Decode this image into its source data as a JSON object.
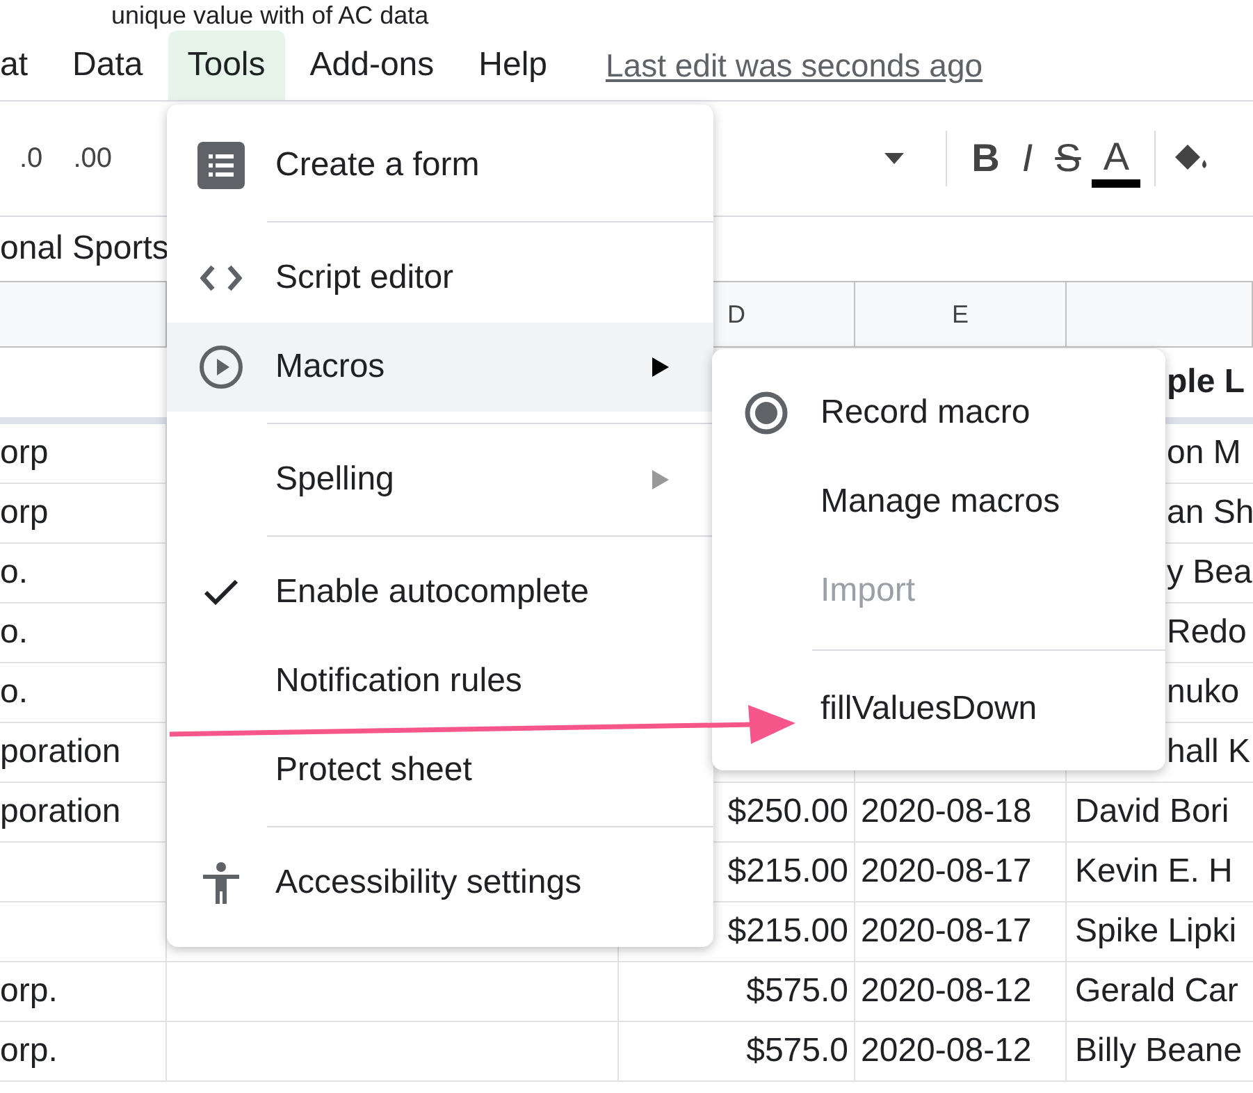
{
  "title": "unique value with of AC data",
  "menubar": [
    {
      "label": "at",
      "selected": false
    },
    {
      "label": "Data",
      "selected": false
    },
    {
      "label": "Tools",
      "selected": true
    },
    {
      "label": "Add-ons",
      "selected": false
    },
    {
      "label": "Help",
      "selected": false
    }
  ],
  "last_edit": "Last edit was seconds ago",
  "toolbar": {
    "decimals": [
      ".0",
      ".00"
    ],
    "format": [
      "B",
      "I",
      "S",
      "A"
    ]
  },
  "formula_bar": "onal Sports",
  "columns": [
    "D",
    "E"
  ],
  "header_cell": "ple L",
  "rows": [
    {
      "a": "orp",
      "amount": "",
      "date": "",
      "f": "on M"
    },
    {
      "a": "orp",
      "amount": "",
      "date": "",
      "f": "an Sh"
    },
    {
      "a": "o.",
      "amount": "",
      "date": "",
      "f": "y Bea"
    },
    {
      "a": "o.",
      "amount": "",
      "date": "",
      "f": "Redo"
    },
    {
      "a": "o.",
      "amount": "",
      "date": "",
      "f": "nuko"
    },
    {
      "a": "poration",
      "amount": "",
      "date": "",
      "f": "hall K"
    },
    {
      "a": "poration",
      "amount": "$250.00",
      "date": "2020-08-18",
      "f": "David Bori"
    },
    {
      "a": "",
      "amount": "$215.00",
      "date": "2020-08-17",
      "f": "Kevin E. H"
    },
    {
      "a": "",
      "amount": "$215.00",
      "date": "2020-08-17",
      "f": "Spike Lipki"
    },
    {
      "a": "orp.",
      "amount": "$575.0",
      "date": "2020-08-12",
      "f": "Gerald Car"
    },
    {
      "a": "orp.",
      "amount": "$575.0",
      "date": "2020-08-12",
      "f": "Billy Beane"
    }
  ],
  "tools_menu": [
    {
      "kind": "item",
      "label": "Create a form",
      "selected": false,
      "checked": false,
      "submenu": false
    },
    {
      "kind": "divider"
    },
    {
      "kind": "item",
      "label": "Script editor",
      "selected": false,
      "checked": false,
      "submenu": false
    },
    {
      "kind": "item",
      "label": "Macros",
      "selected": true,
      "checked": false,
      "submenu": true
    },
    {
      "kind": "divider"
    },
    {
      "kind": "item",
      "label": "Spelling",
      "selected": false,
      "checked": false,
      "submenu": true
    },
    {
      "kind": "divider"
    },
    {
      "kind": "item",
      "label": "Enable autocomplete",
      "selected": false,
      "checked": true,
      "submenu": false
    },
    {
      "kind": "item",
      "label": "Notification rules",
      "selected": false,
      "checked": false,
      "submenu": false
    },
    {
      "kind": "item",
      "label": "Protect sheet",
      "selected": false,
      "checked": false,
      "submenu": false
    },
    {
      "kind": "divider"
    },
    {
      "kind": "item",
      "label": "Accessibility settings",
      "selected": false,
      "checked": false,
      "submenu": false
    }
  ],
  "macros_menu": [
    {
      "kind": "item",
      "label": "Record macro",
      "disabled": false
    },
    {
      "kind": "item",
      "label": "Manage macros",
      "disabled": false
    },
    {
      "kind": "item",
      "label": "Import",
      "disabled": true
    },
    {
      "kind": "divider"
    },
    {
      "kind": "item",
      "label": "fillValuesDown",
      "disabled": false
    }
  ]
}
